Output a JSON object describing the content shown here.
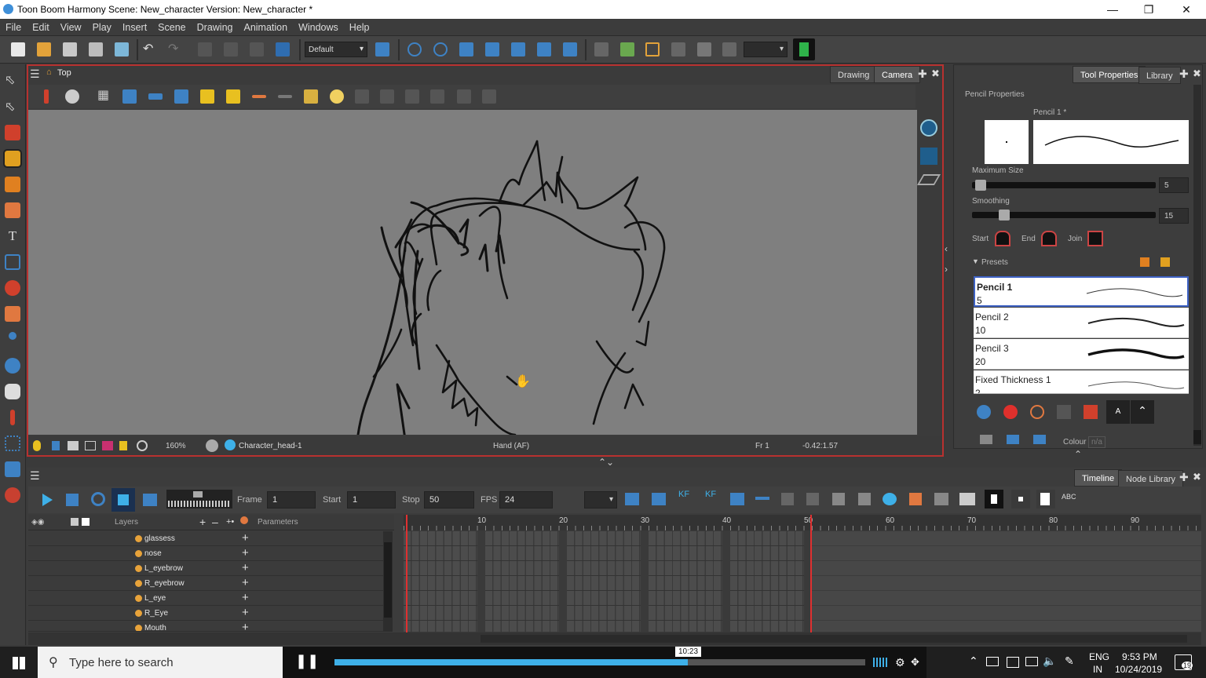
{
  "window": {
    "title": "Toon Boom Harmony Scene: New_character Version: New_character *"
  },
  "menu": [
    "File",
    "Edit",
    "View",
    "Play",
    "Insert",
    "Scene",
    "Drawing",
    "Animation",
    "Windows",
    "Help"
  ],
  "toolbar": {
    "workspace": "Default"
  },
  "camera_view": {
    "breadcrumb": "Top",
    "tabs": [
      "Drawing",
      "Camera"
    ],
    "active_tab": "Camera",
    "status": {
      "zoom": "160%",
      "drawing": "Character_head-1",
      "tool": "Hand (AF)",
      "frame": "Fr 1",
      "coords": "-0.42:1.57"
    }
  },
  "tool_properties": {
    "tabs": [
      "Tool Properties",
      "Library"
    ],
    "active_tab": "Tool Properties",
    "heading": "Pencil Properties",
    "preset_name": "Pencil 1 *",
    "max_size_label": "Maximum Size",
    "max_size_value": "5",
    "max_size_level": 0.03,
    "smoothing_label": "Smoothing",
    "smoothing_value": "15",
    "smoothing_level": 0.15,
    "start_label": "Start",
    "end_label": "End",
    "join_label": "Join",
    "presets_label": "Presets",
    "presets": [
      {
        "name": "Pencil 1",
        "size": "5",
        "selected": true
      },
      {
        "name": "Pencil 2",
        "size": "10"
      },
      {
        "name": "Pencil 3",
        "size": "20"
      },
      {
        "name": "Fixed Thickness 1",
        "size": "2"
      }
    ],
    "colour_label": "Colour",
    "colour_value": "n/a"
  },
  "timeline": {
    "tabs": [
      "Timeline",
      "Node Library"
    ],
    "active_tab": "Timeline",
    "frame_label": "Frame",
    "frame": "1",
    "start_label": "Start",
    "start": "1",
    "stop_label": "Stop",
    "stop": "50",
    "fps_label": "FPS",
    "fps": "24",
    "layers_header": "Layers",
    "params_header": "Parameters",
    "layers": [
      "glassess",
      "nose",
      "L_eyebrow",
      "R_eyebrow",
      "L_eye",
      "R_Eye",
      "Mouth"
    ],
    "ruler_marks": [
      "10",
      "20",
      "30",
      "40",
      "50",
      "60",
      "70",
      "80",
      "90"
    ]
  },
  "taskbar": {
    "search_placeholder": "Type here to search",
    "video_time": "10:23",
    "lang": "ENG",
    "region": "IN",
    "time": "9:53 PM",
    "date": "10/24/2019",
    "notifications": "19"
  }
}
